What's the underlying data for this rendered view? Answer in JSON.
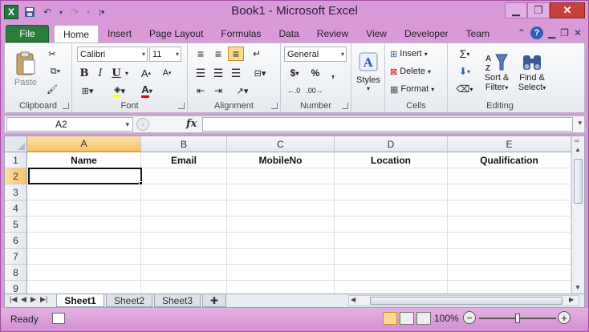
{
  "app": {
    "title": "Book1 - Microsoft Excel",
    "logo": "X"
  },
  "ribbon_tabs": [
    "Home",
    "Insert",
    "Page Layout",
    "Formulas",
    "Data",
    "Review",
    "View",
    "Developer",
    "Team"
  ],
  "file_tab": "File",
  "active_tab": "Home",
  "clipboard": {
    "paste": "Paste",
    "label": "Clipboard"
  },
  "font": {
    "name": "Calibri",
    "size": "11",
    "label": "Font",
    "bold": "B",
    "italic": "I",
    "underline": "U"
  },
  "alignment": {
    "label": "Alignment"
  },
  "number": {
    "format": "General",
    "label": "Number",
    "currency": "$",
    "percent": "%",
    "comma": ","
  },
  "styles": {
    "label": "Styles"
  },
  "cells": {
    "insert": "Insert",
    "delete": "Delete",
    "format": "Format",
    "label": "Cells"
  },
  "editing": {
    "sort": "Sort &",
    "filter": "Filter",
    "find": "Find &",
    "select": "Select",
    "label": "Editing"
  },
  "formula_bar": {
    "name_box": "A2",
    "fx": "fx",
    "value": ""
  },
  "columns": [
    "A",
    "B",
    "C",
    "D",
    "E"
  ],
  "rows": [
    "1",
    "2",
    "3",
    "4",
    "5",
    "6",
    "7",
    "8",
    "9"
  ],
  "headers": [
    "Name",
    "Email",
    "MobileNo",
    "Location",
    "Qualification"
  ],
  "sheets": [
    "Sheet1",
    "Sheet2",
    "Sheet3"
  ],
  "active_sheet": "Sheet1",
  "status": {
    "ready": "Ready",
    "zoom": "100%",
    "zoom_level": 1.0
  },
  "colors": {
    "frame": "#d99ad9",
    "file_tab": "#2a7d3b",
    "selected_header": "#f5c56b"
  }
}
